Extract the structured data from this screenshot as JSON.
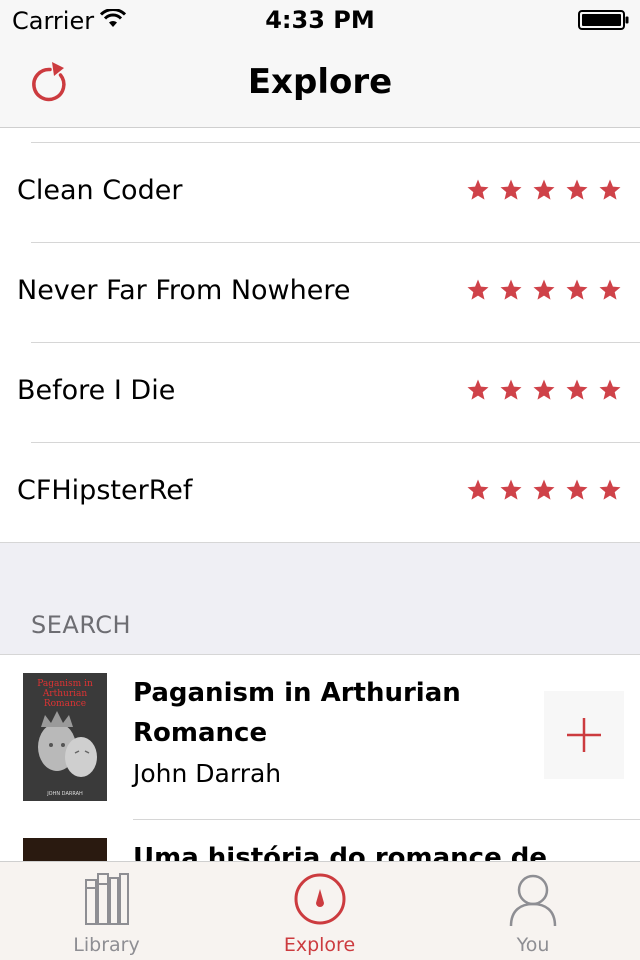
{
  "status_bar": {
    "carrier": "Carrier",
    "time": "4:33 PM"
  },
  "nav": {
    "title": "Explore",
    "refresh_icon": "refresh-icon"
  },
  "top_rated": [
    {
      "title": "Clean Coder",
      "stars": 5
    },
    {
      "title": "Never Far From Nowhere",
      "stars": 5
    },
    {
      "title": "Before I Die",
      "stars": 5
    },
    {
      "title": "CFHipsterRef",
      "stars": 5
    }
  ],
  "search": {
    "header": "SEARCH",
    "results": [
      {
        "title": "Paganism in Arthurian Romance",
        "author": "John Darrah",
        "cover_title": "Paganism in Arthurian Romance",
        "cover_author": "JOHN DARRAH"
      },
      {
        "title": "Uma história do romance de",
        "author": ""
      }
    ]
  },
  "tabs": [
    {
      "label": "Library",
      "icon": "library-icon",
      "active": false
    },
    {
      "label": "Explore",
      "icon": "explore-icon",
      "active": true
    },
    {
      "label": "You",
      "icon": "profile-icon",
      "active": false
    }
  ],
  "colors": {
    "accent": "#cc3b3f",
    "star": "#cf4249",
    "inactive": "#8e8e93",
    "bar_bg": "#f7f7f7"
  }
}
